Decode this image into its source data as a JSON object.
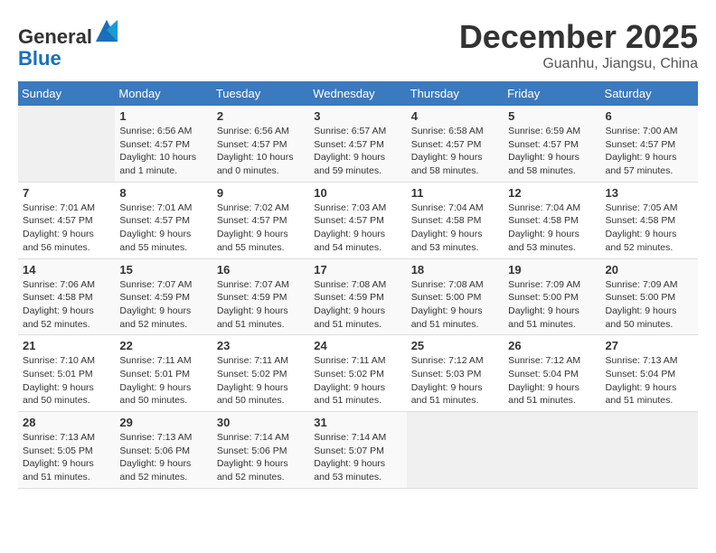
{
  "header": {
    "logo_line1": "General",
    "logo_line2": "Blue",
    "month": "December 2025",
    "location": "Guanhu, Jiangsu, China"
  },
  "weekdays": [
    "Sunday",
    "Monday",
    "Tuesday",
    "Wednesday",
    "Thursday",
    "Friday",
    "Saturday"
  ],
  "weeks": [
    [
      {
        "day": "",
        "sunrise": "",
        "sunset": "",
        "daylight": ""
      },
      {
        "day": "1",
        "sunrise": "Sunrise: 6:56 AM",
        "sunset": "Sunset: 4:57 PM",
        "daylight": "Daylight: 10 hours and 1 minute."
      },
      {
        "day": "2",
        "sunrise": "Sunrise: 6:56 AM",
        "sunset": "Sunset: 4:57 PM",
        "daylight": "Daylight: 10 hours and 0 minutes."
      },
      {
        "day": "3",
        "sunrise": "Sunrise: 6:57 AM",
        "sunset": "Sunset: 4:57 PM",
        "daylight": "Daylight: 9 hours and 59 minutes."
      },
      {
        "day": "4",
        "sunrise": "Sunrise: 6:58 AM",
        "sunset": "Sunset: 4:57 PM",
        "daylight": "Daylight: 9 hours and 58 minutes."
      },
      {
        "day": "5",
        "sunrise": "Sunrise: 6:59 AM",
        "sunset": "Sunset: 4:57 PM",
        "daylight": "Daylight: 9 hours and 58 minutes."
      },
      {
        "day": "6",
        "sunrise": "Sunrise: 7:00 AM",
        "sunset": "Sunset: 4:57 PM",
        "daylight": "Daylight: 9 hours and 57 minutes."
      }
    ],
    [
      {
        "day": "7",
        "sunrise": "Sunrise: 7:01 AM",
        "sunset": "Sunset: 4:57 PM",
        "daylight": "Daylight: 9 hours and 56 minutes."
      },
      {
        "day": "8",
        "sunrise": "Sunrise: 7:01 AM",
        "sunset": "Sunset: 4:57 PM",
        "daylight": "Daylight: 9 hours and 55 minutes."
      },
      {
        "day": "9",
        "sunrise": "Sunrise: 7:02 AM",
        "sunset": "Sunset: 4:57 PM",
        "daylight": "Daylight: 9 hours and 55 minutes."
      },
      {
        "day": "10",
        "sunrise": "Sunrise: 7:03 AM",
        "sunset": "Sunset: 4:57 PM",
        "daylight": "Daylight: 9 hours and 54 minutes."
      },
      {
        "day": "11",
        "sunrise": "Sunrise: 7:04 AM",
        "sunset": "Sunset: 4:58 PM",
        "daylight": "Daylight: 9 hours and 53 minutes."
      },
      {
        "day": "12",
        "sunrise": "Sunrise: 7:04 AM",
        "sunset": "Sunset: 4:58 PM",
        "daylight": "Daylight: 9 hours and 53 minutes."
      },
      {
        "day": "13",
        "sunrise": "Sunrise: 7:05 AM",
        "sunset": "Sunset: 4:58 PM",
        "daylight": "Daylight: 9 hours and 52 minutes."
      }
    ],
    [
      {
        "day": "14",
        "sunrise": "Sunrise: 7:06 AM",
        "sunset": "Sunset: 4:58 PM",
        "daylight": "Daylight: 9 hours and 52 minutes."
      },
      {
        "day": "15",
        "sunrise": "Sunrise: 7:07 AM",
        "sunset": "Sunset: 4:59 PM",
        "daylight": "Daylight: 9 hours and 52 minutes."
      },
      {
        "day": "16",
        "sunrise": "Sunrise: 7:07 AM",
        "sunset": "Sunset: 4:59 PM",
        "daylight": "Daylight: 9 hours and 51 minutes."
      },
      {
        "day": "17",
        "sunrise": "Sunrise: 7:08 AM",
        "sunset": "Sunset: 4:59 PM",
        "daylight": "Daylight: 9 hours and 51 minutes."
      },
      {
        "day": "18",
        "sunrise": "Sunrise: 7:08 AM",
        "sunset": "Sunset: 5:00 PM",
        "daylight": "Daylight: 9 hours and 51 minutes."
      },
      {
        "day": "19",
        "sunrise": "Sunrise: 7:09 AM",
        "sunset": "Sunset: 5:00 PM",
        "daylight": "Daylight: 9 hours and 51 minutes."
      },
      {
        "day": "20",
        "sunrise": "Sunrise: 7:09 AM",
        "sunset": "Sunset: 5:00 PM",
        "daylight": "Daylight: 9 hours and 50 minutes."
      }
    ],
    [
      {
        "day": "21",
        "sunrise": "Sunrise: 7:10 AM",
        "sunset": "Sunset: 5:01 PM",
        "daylight": "Daylight: 9 hours and 50 minutes."
      },
      {
        "day": "22",
        "sunrise": "Sunrise: 7:11 AM",
        "sunset": "Sunset: 5:01 PM",
        "daylight": "Daylight: 9 hours and 50 minutes."
      },
      {
        "day": "23",
        "sunrise": "Sunrise: 7:11 AM",
        "sunset": "Sunset: 5:02 PM",
        "daylight": "Daylight: 9 hours and 50 minutes."
      },
      {
        "day": "24",
        "sunrise": "Sunrise: 7:11 AM",
        "sunset": "Sunset: 5:02 PM",
        "daylight": "Daylight: 9 hours and 51 minutes."
      },
      {
        "day": "25",
        "sunrise": "Sunrise: 7:12 AM",
        "sunset": "Sunset: 5:03 PM",
        "daylight": "Daylight: 9 hours and 51 minutes."
      },
      {
        "day": "26",
        "sunrise": "Sunrise: 7:12 AM",
        "sunset": "Sunset: 5:04 PM",
        "daylight": "Daylight: 9 hours and 51 minutes."
      },
      {
        "day": "27",
        "sunrise": "Sunrise: 7:13 AM",
        "sunset": "Sunset: 5:04 PM",
        "daylight": "Daylight: 9 hours and 51 minutes."
      }
    ],
    [
      {
        "day": "28",
        "sunrise": "Sunrise: 7:13 AM",
        "sunset": "Sunset: 5:05 PM",
        "daylight": "Daylight: 9 hours and 51 minutes."
      },
      {
        "day": "29",
        "sunrise": "Sunrise: 7:13 AM",
        "sunset": "Sunset: 5:06 PM",
        "daylight": "Daylight: 9 hours and 52 minutes."
      },
      {
        "day": "30",
        "sunrise": "Sunrise: 7:14 AM",
        "sunset": "Sunset: 5:06 PM",
        "daylight": "Daylight: 9 hours and 52 minutes."
      },
      {
        "day": "31",
        "sunrise": "Sunrise: 7:14 AM",
        "sunset": "Sunset: 5:07 PM",
        "daylight": "Daylight: 9 hours and 53 minutes."
      },
      {
        "day": "",
        "sunrise": "",
        "sunset": "",
        "daylight": ""
      },
      {
        "day": "",
        "sunrise": "",
        "sunset": "",
        "daylight": ""
      },
      {
        "day": "",
        "sunrise": "",
        "sunset": "",
        "daylight": ""
      }
    ]
  ]
}
